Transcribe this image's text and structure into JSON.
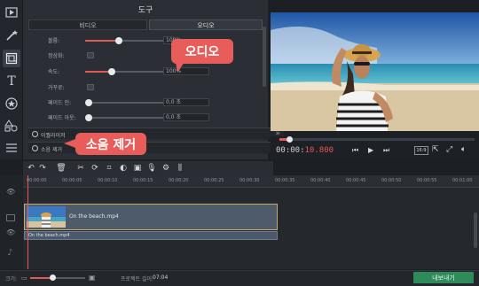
{
  "panel": {
    "title": "도구",
    "tabs": [
      "비디오",
      "오디오"
    ],
    "rows": [
      {
        "label": "볼륨:",
        "value": "100%",
        "fill": 0.42
      },
      {
        "label": "정상화:"
      },
      {
        "label": "속도:",
        "value": "100%",
        "fill": 0.33
      },
      {
        "label": "거꾸로:"
      },
      {
        "label": "페이드 인:",
        "value": "0,0 초"
      },
      {
        "label": "페이드 아웃:",
        "value": "0,0 초"
      }
    ],
    "sections": [
      "이퀄라이저",
      "소음 제거"
    ]
  },
  "callouts": {
    "audio": "오디오",
    "noise": "소음 제거"
  },
  "preview": {
    "time_white": "00:00:",
    "time_red": "10.800",
    "aspect": "16:9"
  },
  "timeline": {
    "ticks": [
      "00:00:00",
      "00:00:05",
      "00:00:10",
      "00:00:15",
      "00:00:20",
      "00:00:25",
      "00:00:30",
      "00:00:35",
      "00:00:40",
      "00:00:45",
      "00:00:50",
      "00:00:55",
      "00:01:00"
    ],
    "video_clip": "On the beach.mp4",
    "audio_clip": "On the beach.mp4"
  },
  "footer": {
    "zoom_label": "크기:",
    "duration_label": "프로젝트 길이:",
    "duration_value": "07:04",
    "export": "내보내기"
  }
}
